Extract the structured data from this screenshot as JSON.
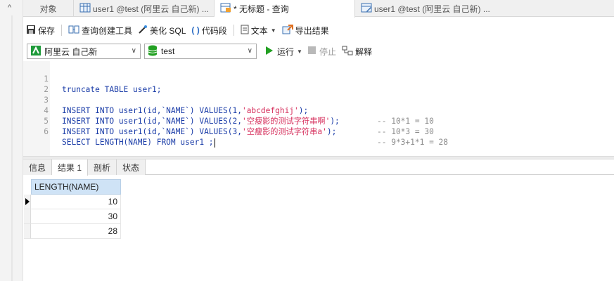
{
  "tabs": [
    {
      "label": "对象",
      "icon": "none"
    },
    {
      "label": "user1 @test (阿里云 自己新) ...",
      "icon": "table-icon"
    },
    {
      "label": "* 无标题 - 查询",
      "icon": "query-icon"
    },
    {
      "label": "user1 @test (阿里云 自己新) ...",
      "icon": "table-design-icon"
    }
  ],
  "toolbar": {
    "save": "保存",
    "query_builder": "查询创建工具",
    "beautify": "美化 SQL",
    "snippet": "代码段",
    "text": "文本",
    "export": "导出结果"
  },
  "connection": {
    "name": "阿里云 自己新",
    "database": "test",
    "run": "运行",
    "stop": "停止",
    "explain": "解释"
  },
  "editor": {
    "lines": [
      {
        "num": "1",
        "code": "truncate TABLE user1;",
        "comment": ""
      },
      {
        "num": "2",
        "code": "",
        "comment": ""
      },
      {
        "num": "3",
        "pre": "INSERT INTO user1(id,`NAME`) VALUES(1,",
        "str": "'abcdefghij'",
        "post": ");",
        "comment": "-- 10*1 = 10"
      },
      {
        "num": "4",
        "pre": "INSERT INTO user1(id,`NAME`) VALUES(2,",
        "str": "'空瘦影的测试字符串啊'",
        "post": ");",
        "comment": "-- 10*3 = 30"
      },
      {
        "num": "5",
        "pre": "INSERT INTO user1(id,`NAME`) VALUES(3,",
        "str": "'空瘦影的测试字符串a'",
        "post": ");",
        "comment": "-- 9*3+1*1 = 28"
      },
      {
        "num": "6",
        "code": "SELECT LENGTH(NAME) FROM user1 ;",
        "comment": ""
      }
    ]
  },
  "result_tabs": [
    "信息",
    "结果 1",
    "剖析",
    "状态"
  ],
  "result": {
    "column": "LENGTH(NAME)",
    "rows": [
      "10",
      "30",
      "28"
    ]
  },
  "colors": {
    "keyword": "#1b3da8",
    "string": "#d6305d",
    "comment": "#8a8a8a",
    "header": "#cfe3f6",
    "run_green": "#22a022"
  }
}
